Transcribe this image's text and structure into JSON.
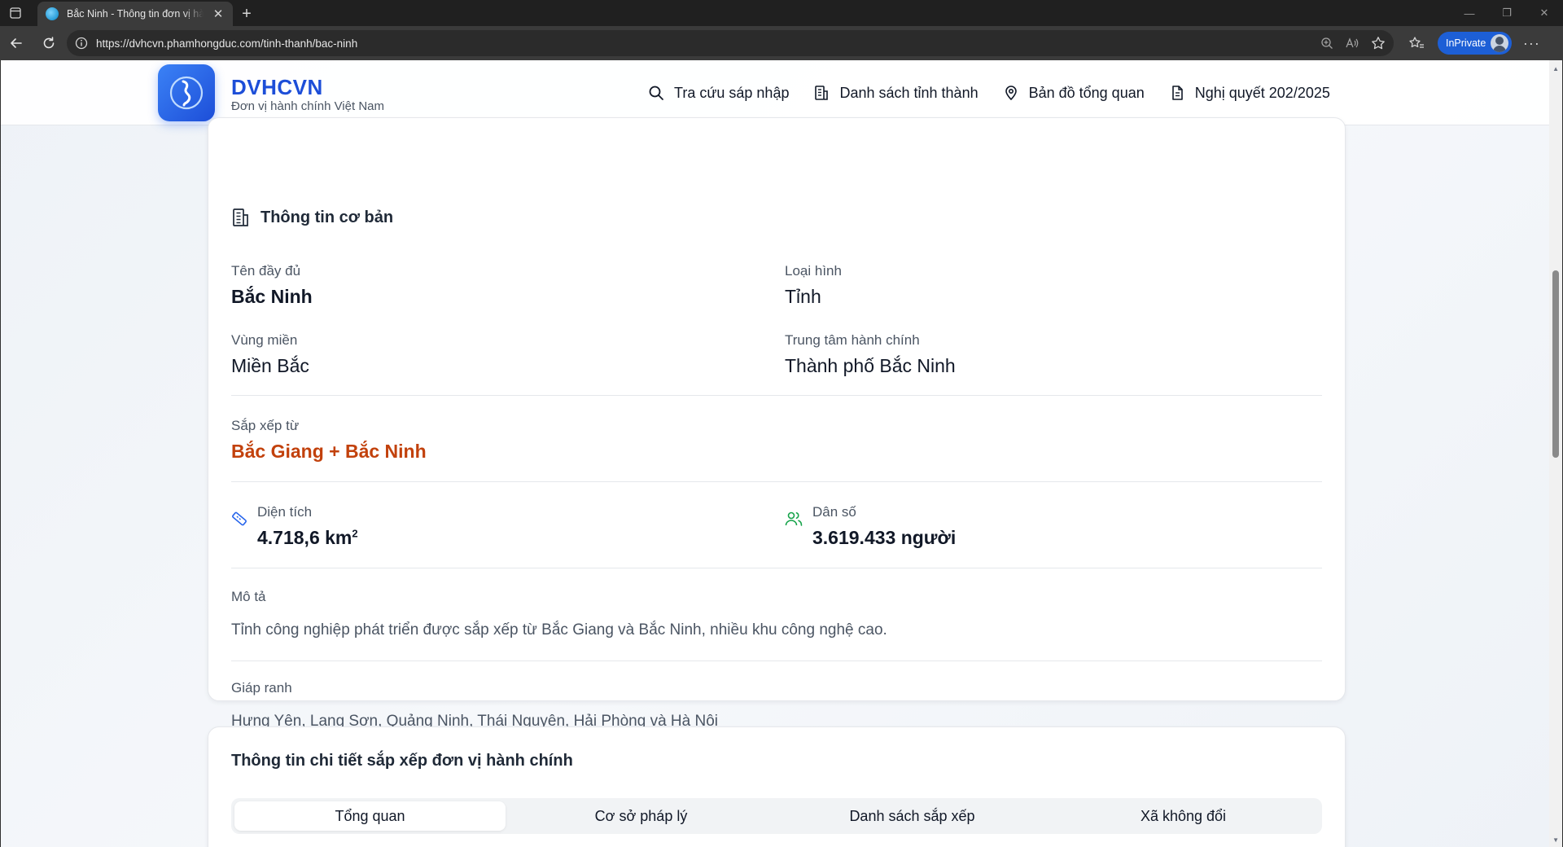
{
  "browser": {
    "tab_title": "Bắc Ninh - Thông tin đơn vị hành chính",
    "url": "https://dvhcvn.phamhongduc.com/tinh-thanh/bac-ninh",
    "inprivate_label": "InPrivate"
  },
  "site": {
    "brand_title": "DVHCVN",
    "brand_subtitle": "Đơn vị hành chính Việt Nam",
    "nav": [
      {
        "label": "Tra cứu sáp nhập",
        "icon": "search-icon"
      },
      {
        "label": "Danh sách tỉnh thành",
        "icon": "building-icon"
      },
      {
        "label": "Bản đồ tổng quan",
        "icon": "map-pin-icon"
      },
      {
        "label": "Nghị quyết 202/2025",
        "icon": "document-icon"
      }
    ]
  },
  "basic_info": {
    "title": "Thông tin cơ bản",
    "full_name_label": "Tên đầy đủ",
    "full_name": "Bắc Ninh",
    "type_label": "Loại hình",
    "type": "Tỉnh",
    "region_label": "Vùng miền",
    "region": "Miền Bắc",
    "admin_center_label": "Trung tâm hành chính",
    "admin_center": "Thành phố Bắc Ninh",
    "merged_from_label": "Sắp xếp từ",
    "merged_from": "Bắc Giang + Bắc Ninh",
    "area_label": "Diện tích",
    "area_value": "4.718,6 km",
    "area_unit_sup": "2",
    "population_label": "Dân số",
    "population_value": "3.619.433 người",
    "description_label": "Mô tả",
    "description": "Tỉnh công nghiệp phát triển được sắp xếp từ Bắc Giang và Bắc Ninh, nhiều khu công nghệ cao.",
    "borders_label": "Giáp ranh",
    "borders": "Hưng Yên, Lạng Sơn, Quảng Ninh, Thái Nguyên, Hải Phòng và Hà Nội"
  },
  "detail": {
    "title": "Thông tin chi tiết sắp xếp đơn vị hành chính",
    "tabs": [
      "Tổng quan",
      "Cơ sở pháp lý",
      "Danh sách sắp xếp",
      "Xã không đổi"
    ],
    "active_tab": 0
  },
  "colors": {
    "brand": "#1d4ed8",
    "accent": "#c2410c",
    "area_icon": "#2563eb",
    "population_icon": "#16a34a"
  }
}
